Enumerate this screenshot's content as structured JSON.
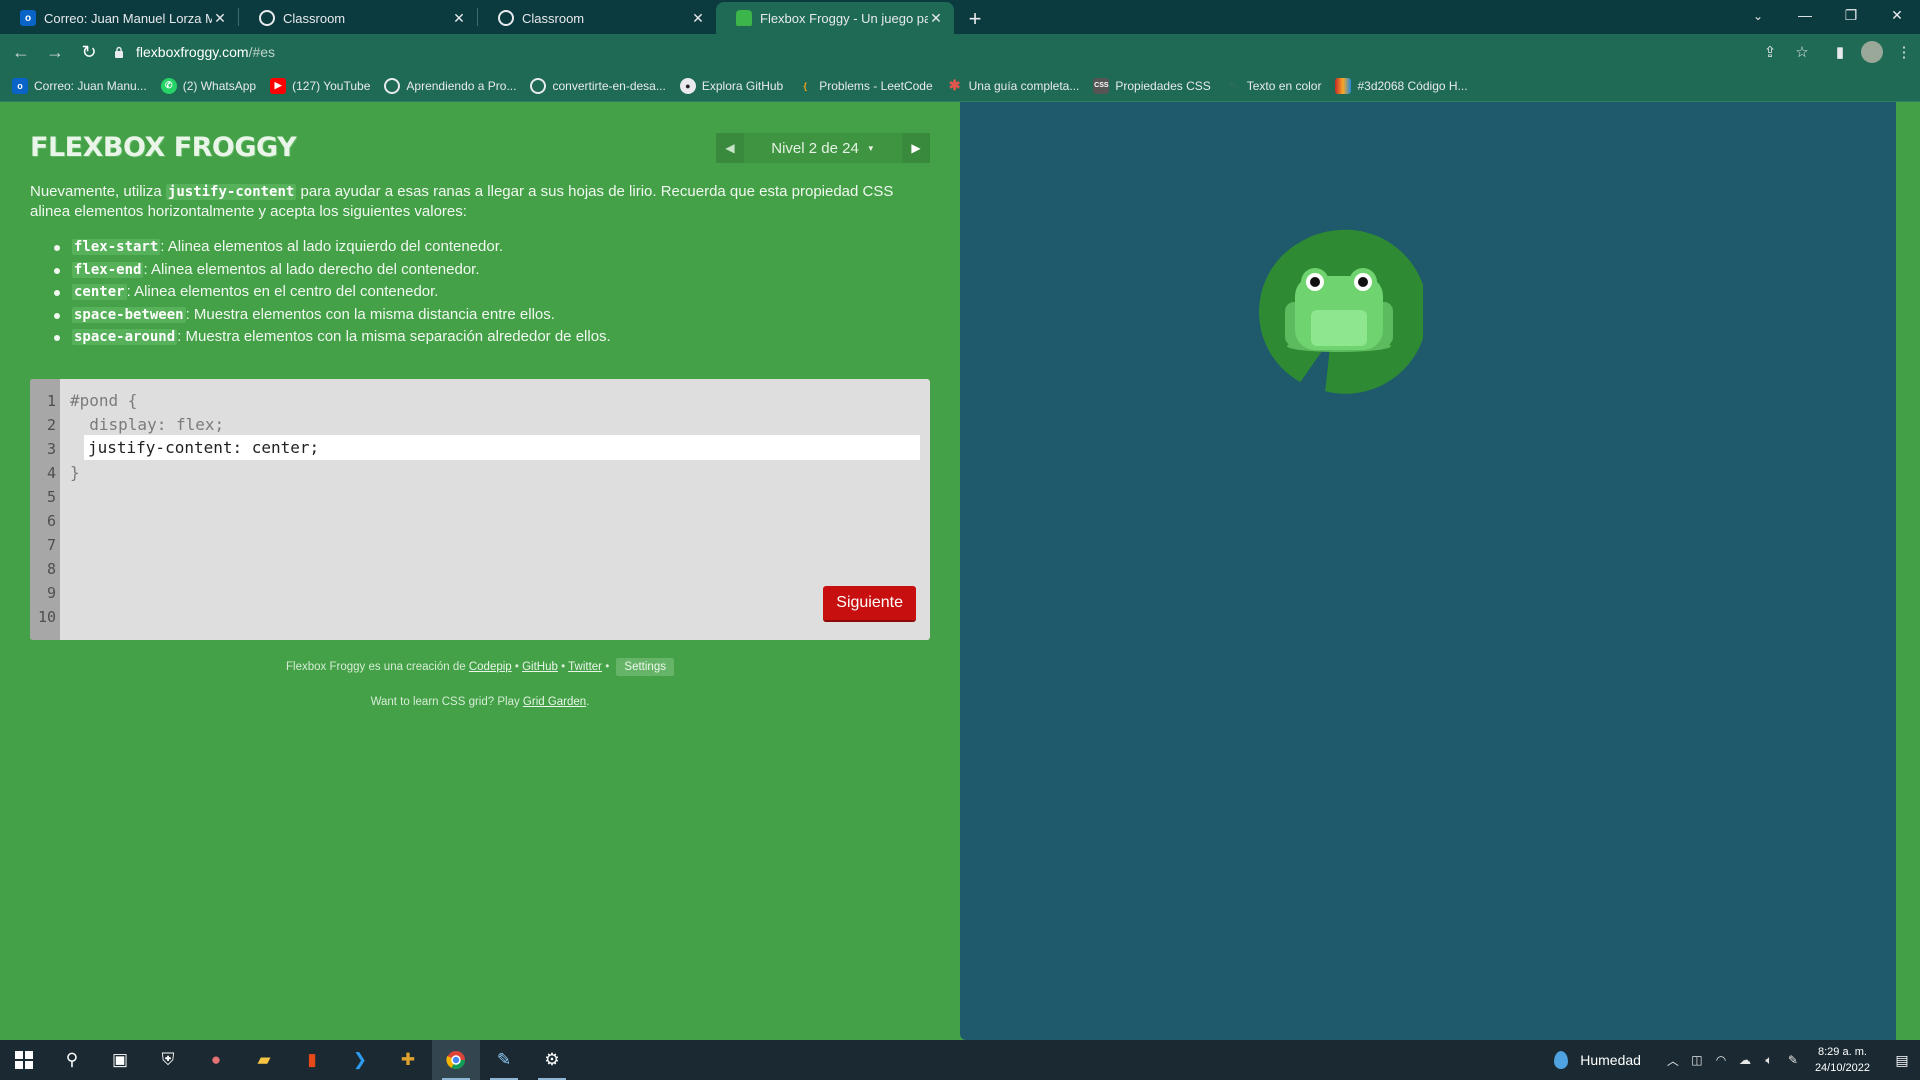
{
  "browser": {
    "tabs": [
      {
        "title": "Correo: Juan Manuel Lorza Mend",
        "icon": "outlook-icon",
        "active": false
      },
      {
        "title": "Classroom",
        "icon": "globe-icon",
        "active": false
      },
      {
        "title": "Classroom",
        "icon": "globe-icon",
        "active": false
      },
      {
        "title": "Flexbox Froggy - Un juego para a",
        "icon": "frog-icon",
        "active": true
      }
    ],
    "new_tab_label": "+",
    "url_host": "flexboxfroggy.com",
    "url_path": "/#es",
    "bookmarks": [
      {
        "label": "Correo: Juan Manu...",
        "icon": "outlook-icon",
        "color": "#0a64c8"
      },
      {
        "label": "(2) WhatsApp",
        "icon": "whatsapp-icon",
        "color": "#25d366"
      },
      {
        "label": "(127) YouTube",
        "icon": "youtube-icon",
        "color": "#ff0000"
      },
      {
        "label": "Aprendiendo a Pro...",
        "icon": "globe-icon",
        "color": "#6b6b6b"
      },
      {
        "label": "convertirte-en-desa...",
        "icon": "globe-icon",
        "color": "#6b6b6b"
      },
      {
        "label": "Explora GitHub",
        "icon": "github-icon",
        "color": "#222222"
      },
      {
        "label": "Problems - LeetCode",
        "icon": "leetcode-icon",
        "color": "#f89f1b"
      },
      {
        "label": "Una guía completa...",
        "icon": "asterisk-icon",
        "color": "#e0574e"
      },
      {
        "label": "Propiedades CSS",
        "icon": "css-icon",
        "color": "#555555"
      },
      {
        "label": "Texto en color",
        "icon": "pen-icon",
        "color": "#2d6b57"
      },
      {
        "label": "#3d2068 Código H...",
        "icon": "palette-icon",
        "color": "#b53b3b"
      }
    ]
  },
  "game": {
    "logo": "FLEXBOX FROGGY",
    "level_label": "Nivel 2 de 24",
    "intro_before": "Nuevamente, utiliza ",
    "intro_code": "justify-content",
    "intro_after": " para ayudar a esas ranas a llegar a sus hojas de lirio. Recuerda que esta propiedad CSS alinea elementos horizontalmente y acepta los siguientes valores:",
    "values": [
      {
        "code": "flex-start",
        "desc": ": Alinea elementos al lado izquierdo del contenedor."
      },
      {
        "code": "flex-end",
        "desc": ": Alinea elementos al lado derecho del contenedor."
      },
      {
        "code": "center",
        "desc": ": Alinea elementos en el centro del contenedor."
      },
      {
        "code": "space-between",
        "desc": ": Muestra elementos con la misma distancia entre ellos."
      },
      {
        "code": "space-around",
        "desc": ": Muestra elementos con la misma separación alrededor de ellos."
      }
    ],
    "editor": {
      "line_numbers": [
        "1",
        "2",
        "3",
        "4",
        "5",
        "6",
        "7",
        "8",
        "9",
        "10"
      ],
      "line1": "#pond {",
      "line2": "  display: flex;",
      "input_value": "justify-content: center;",
      "line4": "}"
    },
    "next_button": "Siguiente",
    "credits_prefix": "Flexbox Froggy es una creación de ",
    "credits_links": [
      "Codepip",
      "GitHub",
      "Twitter"
    ],
    "settings_label": "Settings",
    "grid_prefix": "Want to learn CSS grid? Play ",
    "grid_link": "Grid Garden",
    "grid_suffix": "."
  },
  "taskbar": {
    "weather": "Humedad",
    "time": "8:29 a. m.",
    "date": "24/10/2022"
  },
  "colors": {
    "pond": "#1e5a6b",
    "page_green": "#43a047",
    "lilypad": "#2e8b33",
    "frog": "#6fd36f",
    "next_button": "#c80f0f"
  }
}
